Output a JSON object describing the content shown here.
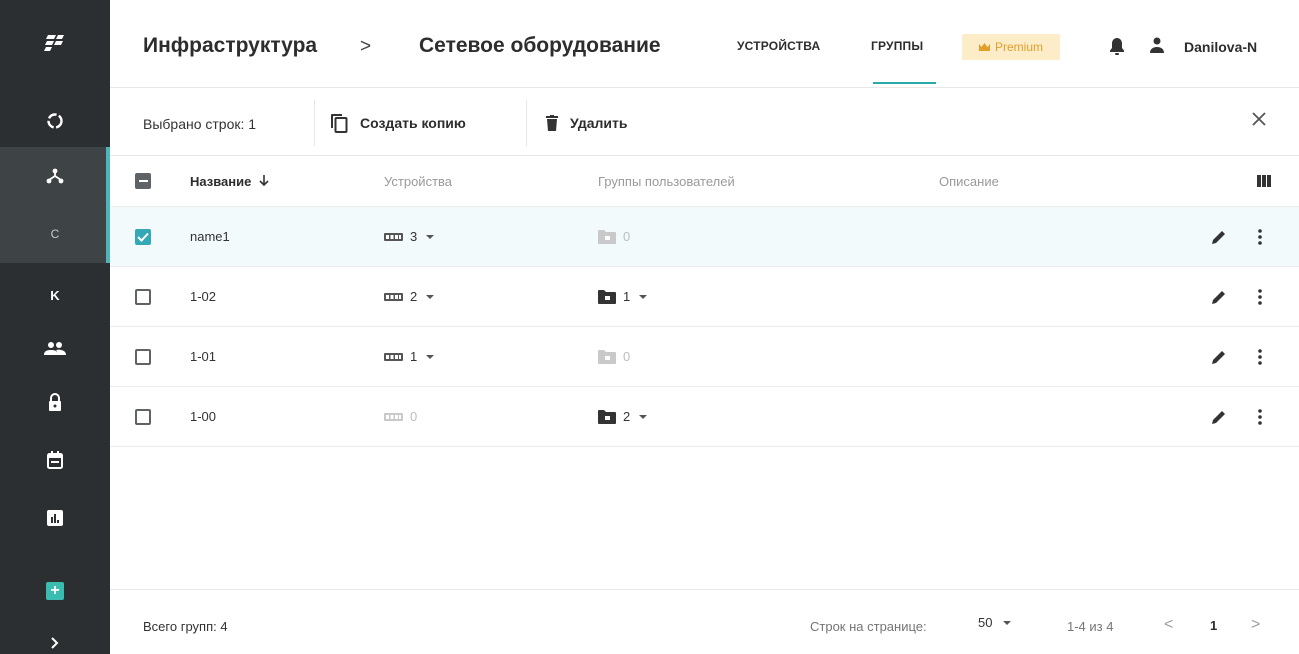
{
  "header": {
    "breadcrumb_root": "Инфраструктура",
    "breadcrumb_separator": ">",
    "breadcrumb_current": "Сетевое оборудование",
    "tabs": [
      {
        "label": "УСТРОЙСТВА",
        "active": false
      },
      {
        "label": "ГРУППЫ",
        "active": true
      }
    ],
    "premium_label": "Premium",
    "username": "Danilova-N"
  },
  "sidebar": {
    "items": [
      {
        "icon": "logo-icon"
      },
      {
        "icon": "circle-dashed-icon"
      },
      {
        "icon": "network-icon",
        "active": true
      },
      {
        "letter": "C",
        "active": true
      },
      {
        "letter": "K"
      },
      {
        "icon": "users-icon"
      },
      {
        "icon": "lock-icon"
      },
      {
        "icon": "calendar-icon"
      },
      {
        "icon": "chart-icon"
      },
      {
        "icon": "add-icon"
      },
      {
        "icon": "chevron-right-icon"
      }
    ]
  },
  "toolbar": {
    "selected_text": "Выбрано строк: 1",
    "copy_label": "Создать копию",
    "delete_label": "Удалить"
  },
  "table": {
    "columns": [
      "Название",
      "Устройства",
      "Группы пользователей",
      "Описание"
    ],
    "rows": [
      {
        "name": "name1",
        "devices": "3",
        "user_groups": "0",
        "checked": true
      },
      {
        "name": "1-02",
        "devices": "2",
        "user_groups": "1",
        "checked": false
      },
      {
        "name": "1-01",
        "devices": "1",
        "user_groups": "0",
        "checked": false
      },
      {
        "name": "1-00",
        "devices": "0",
        "user_groups": "2",
        "checked": false
      }
    ]
  },
  "footer": {
    "total": "Всего групп: 4",
    "rows_per_page_label": "Строк на странице:",
    "rows_per_page_value": "50",
    "range": "1-4 из 4",
    "page": "1",
    "prev": "<",
    "next": ">"
  },
  "colors": {
    "sidebar_bg": "#2b2f31",
    "accent": "#2aa9a9",
    "premium_bg": "#fdecc8",
    "premium_text": "#e0a02a"
  }
}
